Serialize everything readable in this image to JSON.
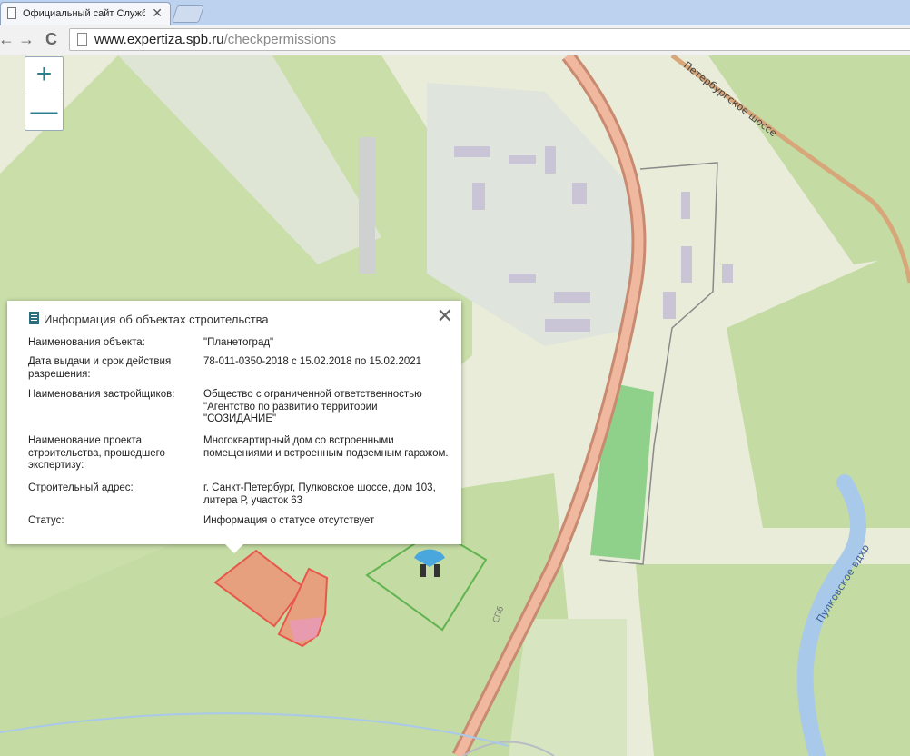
{
  "browser": {
    "tab_title": "Официальный сайт Службы",
    "tab_close": "✕",
    "back": "←",
    "forward": "→",
    "reload": "C",
    "url_domain": "www.expertiza.spb.ru",
    "url_path": "/checkpermissions"
  },
  "map": {
    "zoom_in": "+",
    "zoom_out": "—",
    "labels": {
      "road_top": "Петербургское шоссе",
      "lake": "Пулковское вдхр",
      "road_side": "СПб"
    },
    "colors": {
      "land": "#e8ecd8",
      "green": "#c4dba3",
      "road": "#e2957a",
      "water": "#a9c9ea",
      "field": "#8fd08a",
      "highlight_fill": "#e6a07e",
      "highlight_stroke": "#e7574a",
      "boundary": "#61b450"
    }
  },
  "popup": {
    "title": "Информация об объектах строительства",
    "close": "✕",
    "rows": [
      {
        "k": "Наименования объекта:",
        "v": "\"Планетоград\""
      },
      {
        "k": "Дата выдачи и срок действия разрешения:",
        "v": "78-011-0350-2018 с 15.02.2018 по 15.02.2021"
      },
      {
        "k": "Наименования застройщиков:",
        "v": "Общество с ограниченной ответственностью \"Агентство по развитию территории \"СОЗИДАНИЕ\""
      },
      {
        "k": "Наименование проекта строительства, прошедшего экспертизу:",
        "v": "Многоквартирный дом со встроенными помещениями и встроенным подземным гаражом."
      },
      {
        "k": "Строительный адрес:",
        "v": "г. Санкт-Петербург, Пулковское шоссе, дом 103, литера Р, участок 63"
      },
      {
        "k": "Статус:",
        "v": "Информация о статусе отсутствует"
      }
    ]
  }
}
